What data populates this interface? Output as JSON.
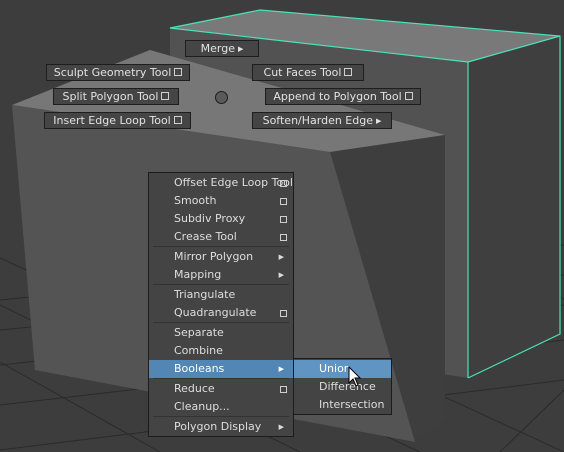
{
  "marking_menu": {
    "north": "Merge",
    "north_west": "Sculpt Geometry Tool",
    "north_east": "Cut Faces Tool",
    "west": "Split Polygon Tool",
    "east": "Append to Polygon Tool",
    "south_west": "Insert Edge Loop Tool",
    "south_east": "Soften/Harden Edge"
  },
  "context_menu": {
    "items": [
      {
        "label": "Offset Edge Loop Tool",
        "option_box": true
      },
      {
        "label": "Smooth",
        "option_box": true
      },
      {
        "label": "Subdiv Proxy",
        "option_box": true
      },
      {
        "label": "Crease Tool",
        "option_box": true
      },
      {
        "label": "Mirror Polygon",
        "submenu": true
      },
      {
        "label": "Mapping",
        "submenu": true
      },
      {
        "label": "Triangulate"
      },
      {
        "label": "Quadrangulate",
        "option_box": true
      },
      {
        "label": "Separate"
      },
      {
        "label": "Combine"
      },
      {
        "label": "Booleans",
        "submenu": true,
        "highlighted": true
      },
      {
        "label": "Reduce",
        "option_box": true
      },
      {
        "label": "Cleanup..."
      },
      {
        "label": "Polygon Display",
        "submenu": true
      }
    ]
  },
  "booleans_submenu": {
    "items": [
      {
        "label": "Union",
        "highlighted": true
      },
      {
        "label": "Difference"
      },
      {
        "label": "Intersection"
      }
    ]
  },
  "colors": {
    "viewport_bg": "#3c3c3c",
    "grid": "#2a2a2a",
    "object_face": "#4f4f4f",
    "object_top": "#777777",
    "selection_outline": "#4be3b6",
    "menu_bg": "#444444",
    "highlight": "#5186b5"
  },
  "icons": [
    "option-box-icon",
    "submenu-arrow-icon",
    "mouse-cursor-icon"
  ]
}
